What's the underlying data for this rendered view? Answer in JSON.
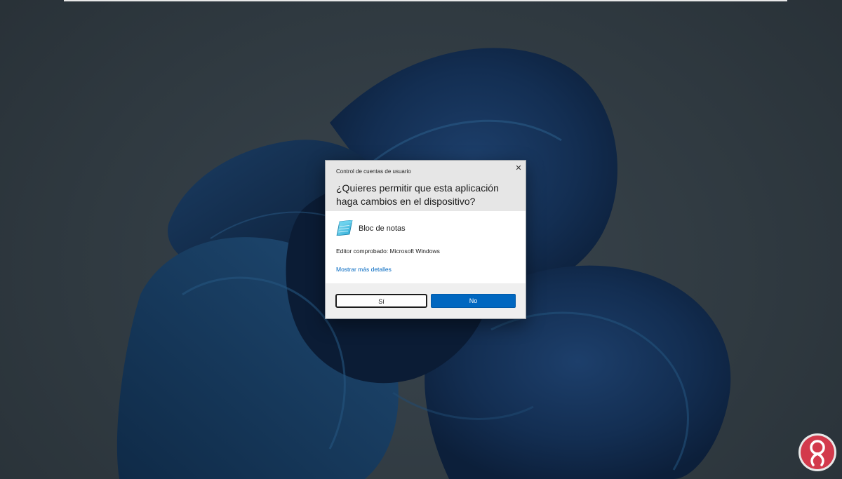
{
  "desktop": {
    "wallpaper": "windows-11-bloom-dark"
  },
  "uac": {
    "title": "Control de cuentas de usuario",
    "question": "¿Quieres permitir que esta aplicación haga cambios en el dispositivo?",
    "app_name": "Bloc de notas",
    "app_icon": "notepad-icon",
    "publisher": "Editor comprobado: Microsoft Windows",
    "details_link": "Mostrar más detalles",
    "yes_label": "Sí",
    "no_label": "No",
    "close_icon": "close-icon"
  },
  "watermark": {
    "logo": "solvetic-logo"
  },
  "colors": {
    "accent": "#0067c0",
    "link": "#0067c0",
    "header_bg": "#e6e6e6",
    "footer_bg": "#efefef"
  }
}
